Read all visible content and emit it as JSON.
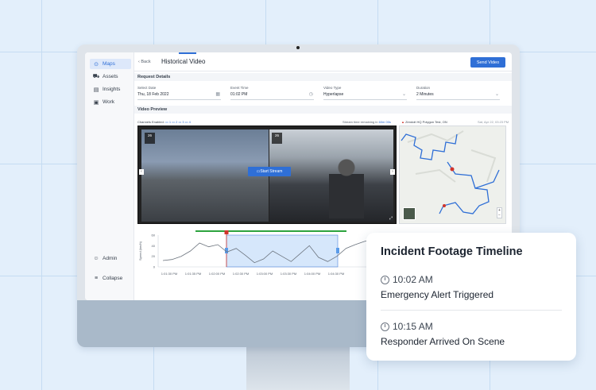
{
  "app": {
    "page_title": "Historical Video",
    "back_label": "Back",
    "send_label": "Send Video"
  },
  "sidebar": {
    "items": [
      {
        "label": "Maps",
        "icon": "map-pin-icon",
        "active": true
      },
      {
        "label": "Assets",
        "icon": "truck-icon",
        "active": false
      },
      {
        "label": "Insights",
        "icon": "chart-icon",
        "active": false
      },
      {
        "label": "Work",
        "icon": "briefcase-icon",
        "active": false
      }
    ],
    "admin_label": "Admin",
    "collapse_label": "Collapse"
  },
  "request": {
    "section_label": "Request Details",
    "date": {
      "label": "Select Date",
      "value": "Thu, 18 Feb 2022"
    },
    "time": {
      "label": "Event Time",
      "value": "01:02 PM"
    },
    "type": {
      "label": "Video Type",
      "value": "Hyperlapse"
    },
    "duration": {
      "label": "Duration",
      "value": "2 Minutes"
    }
  },
  "preview": {
    "section_label": "Video Preview",
    "channels_label": "Channels Enabled:",
    "channels": [
      "1",
      "2",
      "3",
      "4"
    ],
    "stream_note": "Stream time remaining in",
    "stream_time": "60m 00s",
    "location": "Zendoit HQ Polygon Test, ON",
    "date_stamp": "Sat, Apr 22, 03:23 PM",
    "start_stream": "Start Stream",
    "cam_left_num": "26",
    "cam_right_num": "26"
  },
  "chart_data": {
    "type": "line",
    "ylabel": "Speed (km/h)",
    "yticks": [
      "60",
      "40",
      "20",
      "0"
    ],
    "categories": [
      "1:01:30 PM",
      "1:01:35 PM",
      "1:02:00 PM",
      "1:02:30 PM",
      "1:03:00 PM",
      "1:03:30 PM",
      "1:04:00 PM",
      "1:04:30 PM"
    ],
    "values": [
      12,
      14,
      20,
      30,
      45,
      38,
      42,
      28,
      35,
      22,
      8,
      15,
      30,
      20,
      10,
      25,
      40,
      18,
      10,
      20,
      35,
      42,
      48,
      52,
      55,
      50
    ],
    "ylim": [
      0,
      60
    ]
  },
  "card": {
    "title": "Incident Footage Timeline",
    "events": [
      {
        "time": "10:02 AM",
        "label": "Emergency Alert Triggered"
      },
      {
        "time": "10:15 AM",
        "label": "Responder Arrived On Scene"
      }
    ]
  },
  "colors": {
    "accent": "#2f6fd6",
    "timeline_green": "#2da33f",
    "marker_red": "#d0342c"
  }
}
